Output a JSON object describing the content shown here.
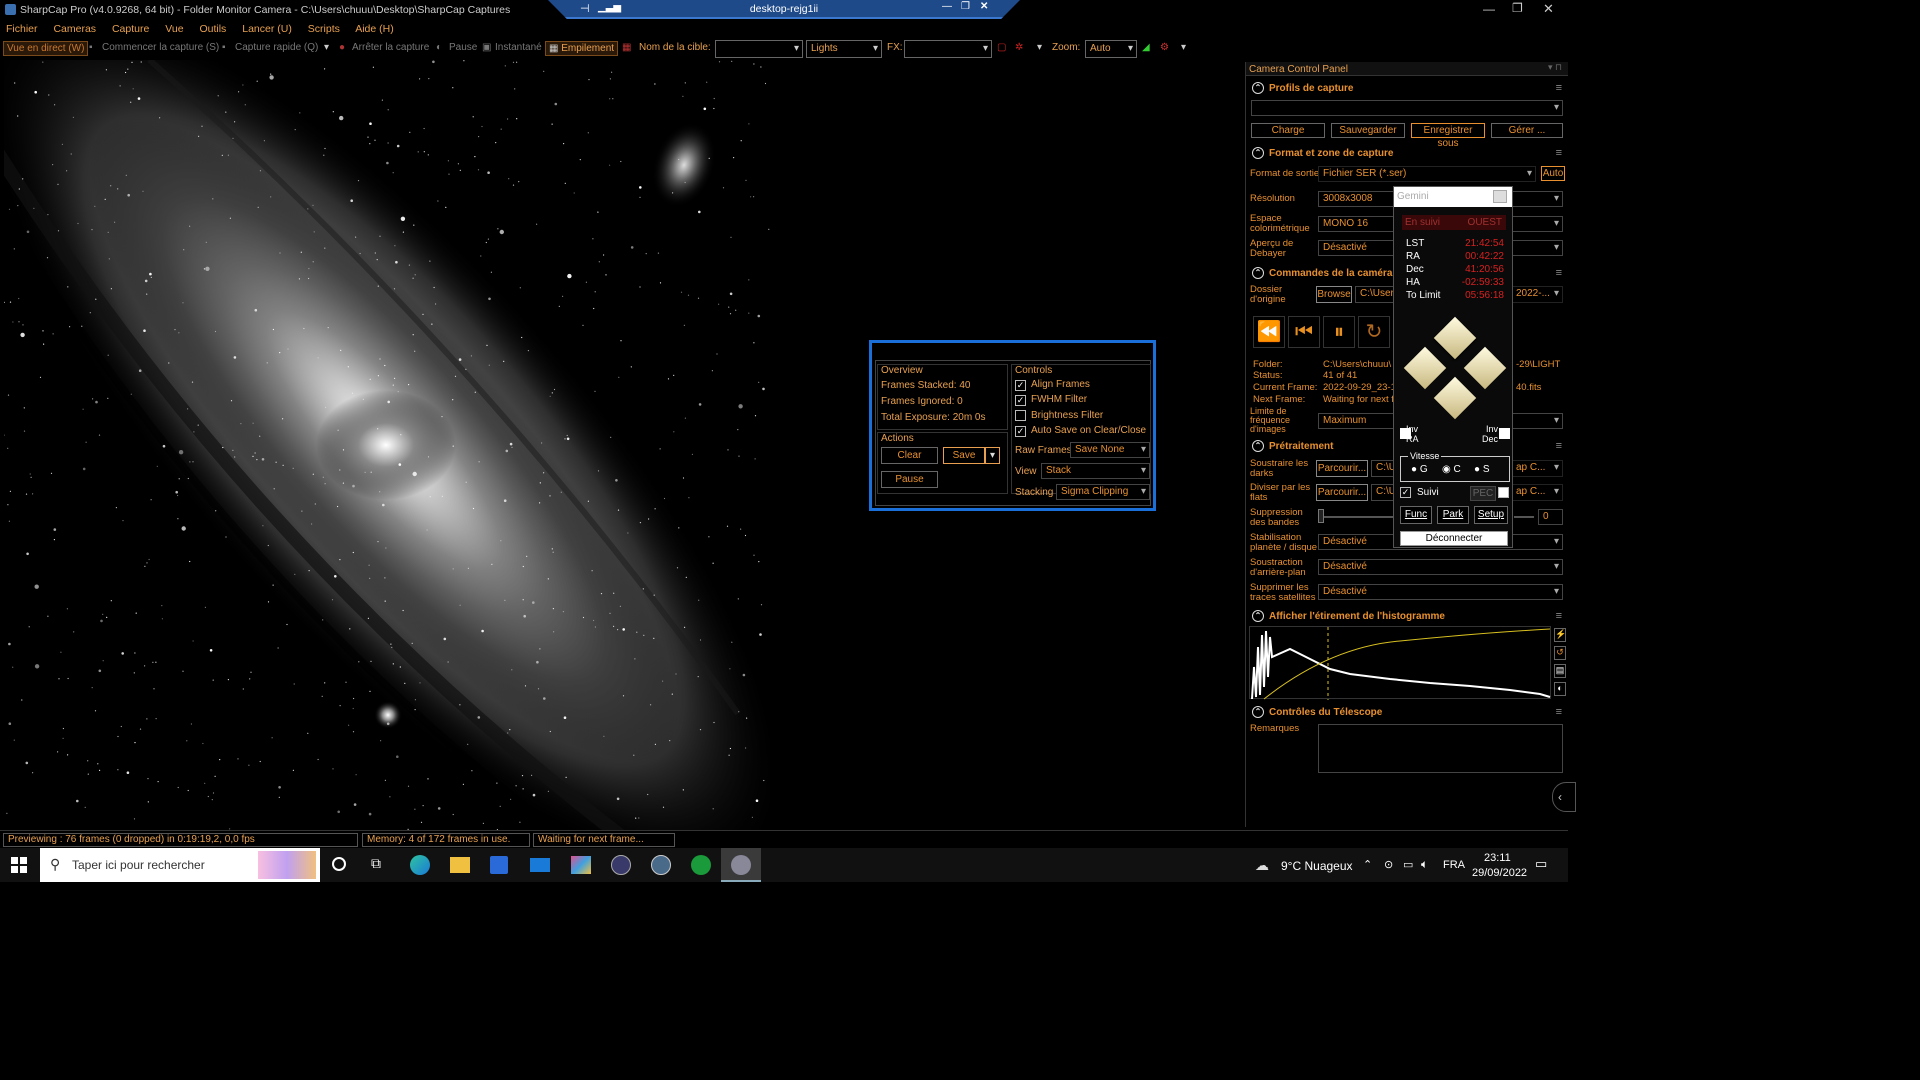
{
  "titlebar": {
    "title": "SharpCap Pro (v4.0.9268, 64 bit) - Folder Monitor Camera - C:\\Users\\chuuu\\Desktop\\SharpCap Captures",
    "rd_host": "desktop-rejg1ii"
  },
  "menu": [
    "Fichier",
    "Cameras",
    "Capture",
    "Vue",
    "Outils",
    "Lancer (U)",
    "Scripts",
    "Aide (H)"
  ],
  "toolbar": {
    "live": "Vue en direct (W)",
    "start": "Commencer la capture (S)",
    "quick": "Capture rapide (Q)",
    "stop": "Arrêter la capture",
    "pause": "Pause",
    "snapshot": "Instantané",
    "stacking": "Empilement",
    "target_label": "Nom de la cible:",
    "target_value": "",
    "frame_type": "Lights",
    "fx_label": "FX:",
    "fx_value": "",
    "zoom_label": "Zoom:",
    "zoom_value": "Auto"
  },
  "stack": {
    "overview": "Overview",
    "stacked": "Frames Stacked: 40",
    "ignored": "Frames Ignored: 0",
    "exposure": "Total Exposure:  20m 0s",
    "actions": "Actions",
    "clear": "Clear",
    "save": "Save",
    "pause": "Pause",
    "controls": "Controls",
    "align": "Align Frames",
    "fwhm": "FWHM Filter",
    "brightness": "Brightness Filter",
    "autosave": "Auto Save on Clear/Close",
    "raw_label": "Raw Frames",
    "raw_value": "Save None",
    "view_label": "View",
    "view_value": "Stack",
    "stacking_label": "Stacking",
    "stacking_value": "Sigma Clipping"
  },
  "panel": {
    "title": "Camera Control Panel",
    "profiles": "Profils de capture",
    "charge": "Charge",
    "sauver": "Sauvegarder",
    "enreg": "Enregistrer sous",
    "gerer": "Gérer ...",
    "format_head": "Format et zone de capture",
    "format_label": "Format de sortie",
    "format_value": "Fichier SER (*.ser)",
    "auto": "Auto",
    "res_label": "Résolution",
    "res_value": "3008x3008",
    "color_label": "Espace colorimétrique",
    "color_value": "MONO 16",
    "debayer_label": "Aperçu de Debayer",
    "debayer_value": "Désactivé",
    "cmd_head": "Commandes de la caméra",
    "origin_label": "Dossier d'origine",
    "browse": "Browse",
    "origin_value": "C:\\Users",
    "origin_tail": "2022-...",
    "folder_l": "Folder:",
    "folder_v": "C:\\Users\\chuuu\\",
    "folder_tail": "-29\\LIGHT",
    "status_l": "Status:",
    "status_v": "41 of 41",
    "current_l": "Current Frame:",
    "current_v": "2022-09-29_23-1",
    "current_tail": "40.fits",
    "next_l": "Next Frame:",
    "next_v": "Waiting for next f",
    "limit_label": "Limite de fréquence d'images",
    "limit_value": "Maximum",
    "pre_head": "Prétraitement",
    "darks_label": "Soustraire les darks",
    "darks_btn": "Parcourir...",
    "darks_path": "C:\\U",
    "darks_tail": "ap C...",
    "flats_label": "Diviser par les flats",
    "flats_btn": "Parcourir...",
    "flats_path": "C:\\U",
    "flats_tail": "ap C...",
    "bands_label": "Suppression des bandes",
    "bands_value": "0",
    "stab_label": "Stabilisation planète / disque",
    "stab_value": "Désactivé",
    "bg_label": "Soustraction d'arrière-plan",
    "bg_value": "Désactivé",
    "sat_label": "Supprimer les traces satellites",
    "sat_value": "Désactivé",
    "hist_head": "Afficher l'étirement de l'histogramme",
    "tel_head": "Contrôles du Télescope",
    "notes_label": "Remarques"
  },
  "gemini": {
    "title": "Gemini",
    "tracking": "En suivi",
    "side": "OUEST",
    "rows": [
      {
        "k": "LST",
        "v": "21:42:54"
      },
      {
        "k": "RA",
        "v": "00:42:22"
      },
      {
        "k": "Dec",
        "v": "41:20:56"
      },
      {
        "k": "HA",
        "v": "-02:59:33"
      },
      {
        "k": "To Limit",
        "v": "05:56:18"
      }
    ],
    "inv_ra": "Inv RA",
    "inv_dec": "Inv Dec",
    "speed": "Vitesse",
    "g": "G",
    "c": "C",
    "s": "S",
    "suivi": "Suivi",
    "pec": "PEC",
    "func": "Func",
    "park": "Park",
    "setup": "Setup",
    "disconnect": "Déconnecter"
  },
  "status": {
    "preview": "Previewing : 76 frames (0 dropped) in 0:19:19,2, 0,0 fps",
    "memory": "Memory: 4 of 172 frames in use.",
    "waiting": "Waiting for next frame..."
  },
  "taskbar": {
    "search": "Taper ici pour rechercher",
    "weather": "9°C  Nuageux",
    "lang": "FRA",
    "time": "23:11",
    "date": "29/09/2022"
  }
}
